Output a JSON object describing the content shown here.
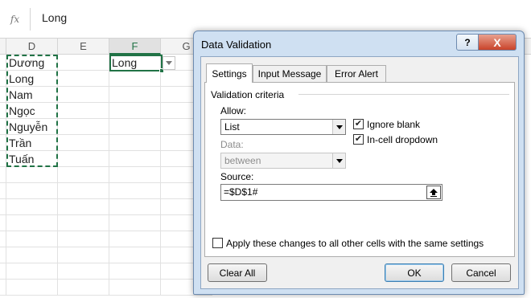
{
  "formula_bar": {
    "fx_label": "fx",
    "value": "Long"
  },
  "columns": [
    "D",
    "E",
    "F",
    "G"
  ],
  "cells": {
    "d_values": [
      "Dương",
      "Long",
      "Nam",
      "Ngọc",
      "Nguyễn",
      "Trần",
      "Tuấn"
    ],
    "f1": "Long"
  },
  "dialog": {
    "title": "Data Validation",
    "help_glyph": "?",
    "close_glyph": "X",
    "tabs": [
      "Settings",
      "Input Message",
      "Error Alert"
    ],
    "active_tab": "Settings",
    "criteria_heading": "Validation criteria",
    "allow_label": "Allow:",
    "allow_value": "List",
    "ignore_blank_label": "Ignore blank",
    "ignore_blank_checked": true,
    "incell_dropdown_label": "In-cell dropdown",
    "incell_dropdown_checked": true,
    "data_label": "Data:",
    "data_value": "between",
    "source_label": "Source:",
    "source_value": "=$D$1#",
    "apply_all_label": "Apply these changes to all other cells with the same settings",
    "apply_all_checked": false,
    "buttons": {
      "clear_all": "Clear All",
      "ok": "OK",
      "cancel": "Cancel"
    }
  },
  "colors": {
    "selection_green": "#217346",
    "dialog_frame": "#cfe0f2",
    "close_red": "#c9432a"
  }
}
